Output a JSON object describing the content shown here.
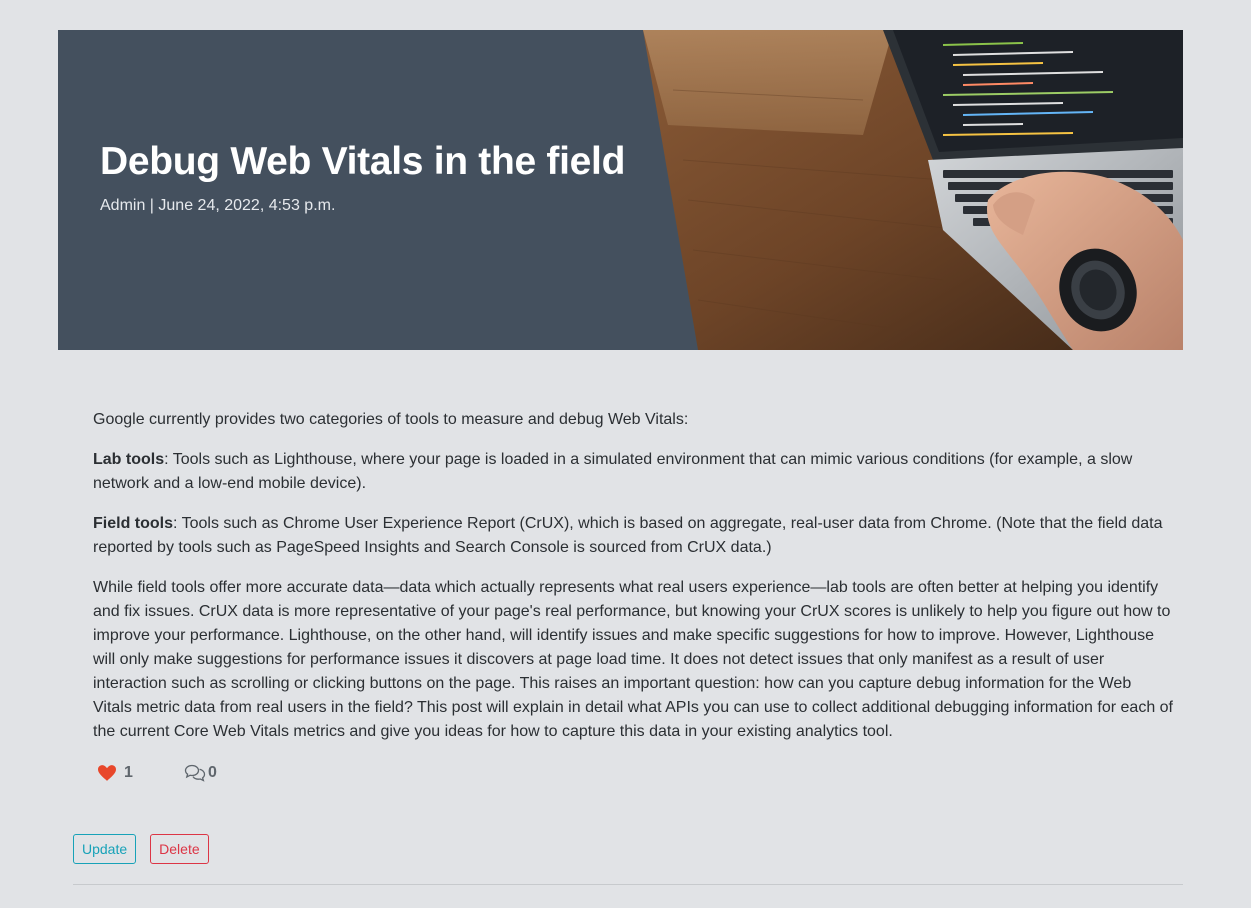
{
  "post": {
    "title": "Debug Web Vitals in the field",
    "meta": "Admin | June 24, 2022, 4:53 p.m.",
    "intro": "Google currently provides two categories of tools to measure and debug Web Vitals:",
    "lab_label": "Lab tools",
    "lab_text": ": Tools such as Lighthouse, where your page is loaded in a simulated environment that can mimic various conditions (for example, a slow network and a low-end mobile device).",
    "field_label": "Field tools",
    "field_text": ": Tools such as Chrome User Experience Report (CrUX), which is based on aggregate, real-user data from Chrome. (Note that the field data reported by tools such as PageSpeed Insights and Search Console is sourced from CrUX data.)",
    "closing": "While field tools offer more accurate data—data which actually represents what real users experience—lab tools are often better at helping you identify and fix issues. CrUX data is more representative of your page's real performance, but knowing your CrUX scores is unlikely to help you figure out how to improve your performance. Lighthouse, on the other hand, will identify issues and make specific suggestions for how to improve. However, Lighthouse will only make suggestions for performance issues it discovers at page load time. It does not detect issues that only manifest as a result of user interaction such as scrolling or clicking buttons on the page. This raises an important question: how can you capture debug information for the Web Vitals metric data from real users in the field? This post will explain in detail what APIs you can use to collect additional debugging information for each of the current Core Web Vitals metrics and give you ideas for how to capture this data in your existing analytics tool."
  },
  "stats": {
    "likes": "1",
    "comments": "0",
    "like_icon": "heart-icon",
    "comment_icon": "comments-icon",
    "like_color": "#e8472b"
  },
  "actions": {
    "update_label": "Update",
    "delete_label": "Delete"
  },
  "hero_image": "laptop-keyboard-photo"
}
